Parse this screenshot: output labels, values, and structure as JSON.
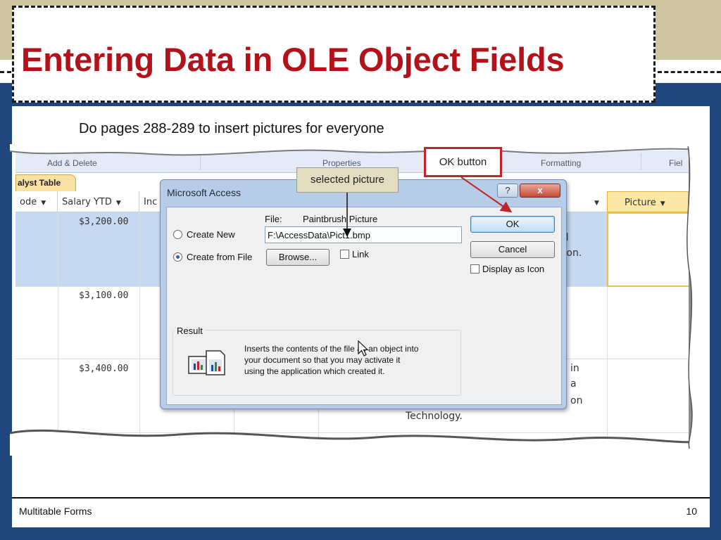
{
  "slide": {
    "title": "Entering Data in OLE Object Fields",
    "instruction": "Do pages 288-289 to insert pictures for everyone",
    "footer_left": "Multitable Forms",
    "page_number": "10"
  },
  "ribbon": {
    "groups": [
      "Add & Delete",
      "Properties",
      "Formatting",
      "Fiel"
    ]
  },
  "datasheet": {
    "tab": "alyst Table",
    "columns": [
      {
        "label": "ode"
      },
      {
        "label": "Salary YTD"
      },
      {
        "label": "Inc"
      },
      {
        "label": "Picture"
      }
    ],
    "rows": [
      {
        "salary": "$3,200.00"
      },
      {
        "salary": "$3,100.00"
      },
      {
        "salary": "$3,400.00"
      }
    ],
    "fragments": [
      "n",
      "al",
      "tion.",
      "in",
      "a",
      "on",
      "Technology."
    ]
  },
  "dialog": {
    "title": "Microsoft Access",
    "help_label": "?",
    "close_label": "x",
    "file_label": "File:",
    "file_type": "Paintbrush Picture",
    "file_path": "F:\\AccessData\\Pict1.bmp",
    "option_create_new": "Create New",
    "option_create_from_file": "Create from File",
    "browse_label": "Browse...",
    "link_label": "Link",
    "ok_label": "OK",
    "cancel_label": "Cancel",
    "display_as_icon_label": "Display as Icon",
    "result_title": "Result",
    "result_text": "Inserts the contents of the file as an object into your document so that you may activate it using the application which created it."
  },
  "callouts": {
    "selected_picture": "selected picture",
    "ok_button": "OK button"
  },
  "colors": {
    "title_red": "#b4121b",
    "slide_blue": "#1f477e",
    "callout_red_border": "#c0232c"
  }
}
